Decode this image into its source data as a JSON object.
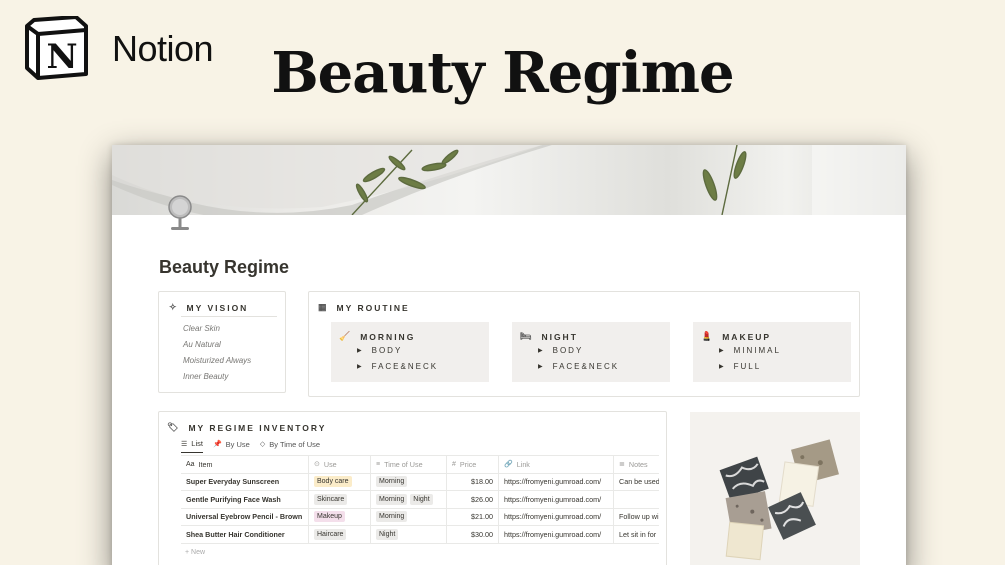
{
  "brand": {
    "name": "Notion",
    "logo_icon": "notion-logo-icon"
  },
  "hero": {
    "title": "Beauty Regime"
  },
  "page": {
    "icon": "mirror-icon",
    "title": "Beauty Regime"
  },
  "vision": {
    "heading": "MY VISION",
    "icon": "sparkle-icon",
    "items": [
      "Clear Skin",
      "Au Natural",
      "Moisturized Always",
      "Inner Beauty"
    ]
  },
  "routine": {
    "heading": "MY ROUTINE",
    "icon": "calendar-icon",
    "cards": [
      {
        "title": "MORNING",
        "icon": "broom-icon",
        "items": [
          "BODY",
          "FACE&NECK"
        ]
      },
      {
        "title": "NIGHT",
        "icon": "bed-icon",
        "items": [
          "BODY",
          "FACE&NECK"
        ]
      },
      {
        "title": "MAKEUP",
        "icon": "lipstick-icon",
        "items": [
          "MINIMAL",
          "FULL"
        ]
      }
    ]
  },
  "inventory": {
    "heading": "MY REGIME INVENTORY",
    "icon": "tag-icon",
    "tabs": [
      {
        "label": "List",
        "icon": "list-icon",
        "active": true
      },
      {
        "label": "By Use",
        "icon": "pin-icon",
        "active": false
      },
      {
        "label": "By Time of Use",
        "icon": "diamond-icon",
        "active": false
      }
    ],
    "columns": [
      "Item",
      "Use",
      "Time of Use",
      "Price",
      "Link",
      "Notes"
    ],
    "rows": [
      {
        "item": "Super Everyday Sunscreen",
        "use": "Body care",
        "time": [
          "Morning"
        ],
        "price": "$18.00",
        "link": "https://fromyeni.gumroad.com/",
        "notes": "Can be used"
      },
      {
        "item": "Gentle Purifying Face Wash",
        "use": "Skincare",
        "time": [
          "Morning",
          "Night"
        ],
        "price": "$26.00",
        "link": "https://fromyeni.gumroad.com/",
        "notes": ""
      },
      {
        "item": "Universal Eyebrow Pencil - Brown",
        "use": "Makeup",
        "time": [
          "Morning"
        ],
        "price": "$21.00",
        "link": "https://fromyeni.gumroad.com/",
        "notes": "Follow up wi"
      },
      {
        "item": "Shea Butter Hair Conditioner",
        "use": "Haircare",
        "time": [
          "Night"
        ],
        "price": "$30.00",
        "link": "https://fromyeni.gumroad.com/",
        "notes": "Let sit in for"
      }
    ],
    "new_label": "+ New"
  }
}
